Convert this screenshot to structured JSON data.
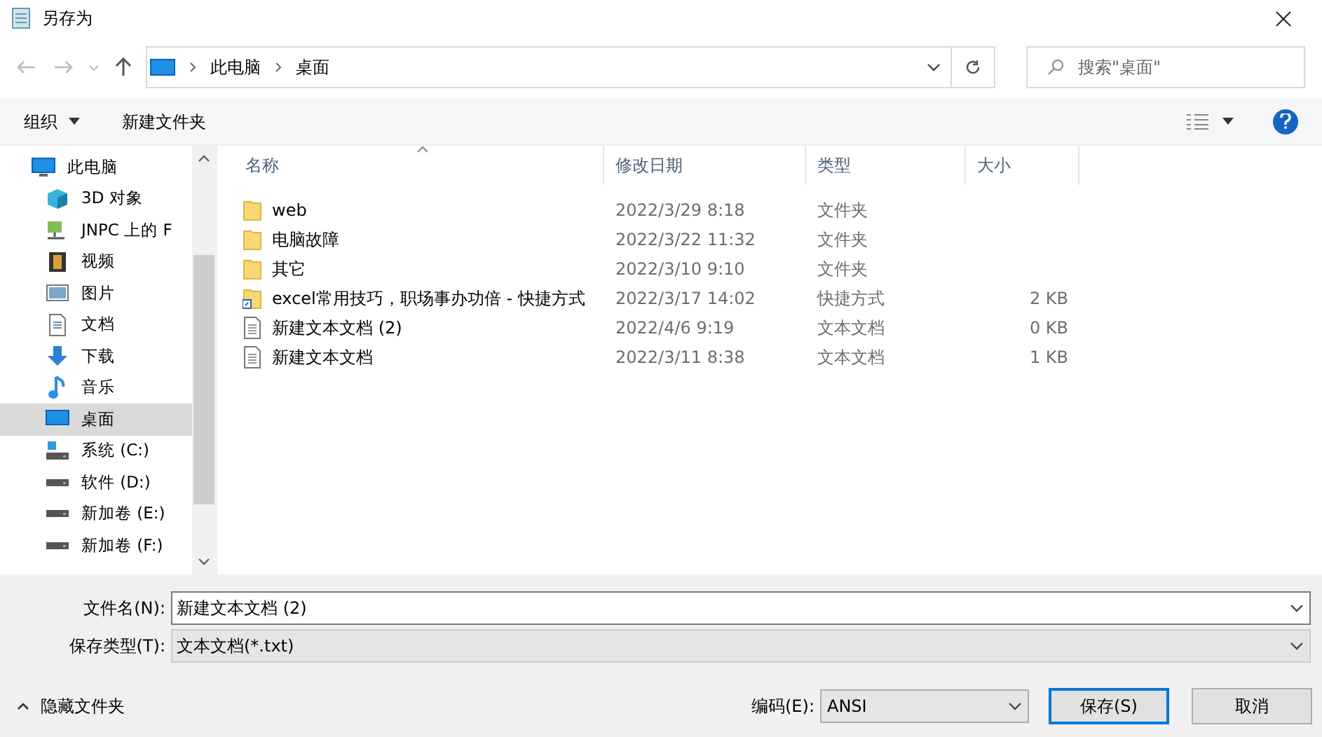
{
  "window": {
    "title": "另存为"
  },
  "address": {
    "crumbs": [
      "此电脑",
      "桌面"
    ]
  },
  "search": {
    "placeholder": "搜索\"桌面\""
  },
  "toolbar": {
    "organize": "组织",
    "new_folder": "新建文件夹"
  },
  "sidebar": {
    "items": [
      {
        "label": "此电脑",
        "kind": "pc",
        "selected": false
      },
      {
        "label": "3D 对象",
        "kind": "cube",
        "selected": false
      },
      {
        "label": "JNPC 上的 F",
        "kind": "netdrive",
        "selected": false
      },
      {
        "label": "视频",
        "kind": "video",
        "selected": false
      },
      {
        "label": "图片",
        "kind": "picture",
        "selected": false
      },
      {
        "label": "文档",
        "kind": "document",
        "selected": false
      },
      {
        "label": "下载",
        "kind": "download",
        "selected": false
      },
      {
        "label": "音乐",
        "kind": "music",
        "selected": false
      },
      {
        "label": "桌面",
        "kind": "desktop",
        "selected": true
      },
      {
        "label": "系统 (C:)",
        "kind": "sysdrive",
        "selected": false
      },
      {
        "label": "软件 (D:)",
        "kind": "drive",
        "selected": false
      },
      {
        "label": "新加卷 (E:)",
        "kind": "drive",
        "selected": false
      },
      {
        "label": "新加卷 (F:)",
        "kind": "drive",
        "selected": false
      }
    ]
  },
  "table": {
    "columns": [
      "名称",
      "修改日期",
      "类型",
      "大小"
    ],
    "rows": [
      {
        "name": "web",
        "date": "2022/3/29 8:18",
        "type": "文件夹",
        "size": "",
        "kind": "folder"
      },
      {
        "name": "电脑故障",
        "date": "2022/3/22 11:32",
        "type": "文件夹",
        "size": "",
        "kind": "folder"
      },
      {
        "name": "其它",
        "date": "2022/3/10 9:10",
        "type": "文件夹",
        "size": "",
        "kind": "folder"
      },
      {
        "name": "excel常用技巧，职场事办功倍 - 快捷方式",
        "date": "2022/3/17 14:02",
        "type": "快捷方式",
        "size": "2 KB",
        "kind": "shortcut"
      },
      {
        "name": "新建文本文档 (2)",
        "date": "2022/4/6 9:19",
        "type": "文本文档",
        "size": "0 KB",
        "kind": "text"
      },
      {
        "name": "新建文本文档",
        "date": "2022/3/11 8:38",
        "type": "文本文档",
        "size": "1 KB",
        "kind": "text"
      }
    ]
  },
  "filename": {
    "label": "文件名(N):",
    "value": "新建文本文档 (2)"
  },
  "filetype": {
    "label": "保存类型(T):",
    "value": "文本文档(*.txt)"
  },
  "footer": {
    "hide_folders": "隐藏文件夹",
    "encoding_label": "编码(E):",
    "encoding": "ANSI",
    "save": "保存(S)",
    "cancel": "取消"
  }
}
